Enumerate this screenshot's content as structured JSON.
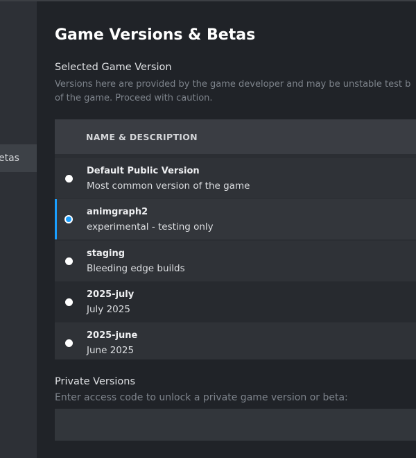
{
  "sidebar": {
    "active_item_label": "etas"
  },
  "page": {
    "title": "Game Versions & Betas"
  },
  "selected_version": {
    "title": "Selected Game Version",
    "description_line1": "Versions here are provided by the game developer and may be unstable test b",
    "description_line2": "of the game. Proceed with caution."
  },
  "versions_table": {
    "column_header": "NAME & DESCRIPTION",
    "rows": [
      {
        "name": "Default Public Version",
        "description": "Most common version of the game",
        "selected": false
      },
      {
        "name": "animgraph2",
        "description": "experimental - testing only",
        "selected": true
      },
      {
        "name": "staging",
        "description": "Bleeding edge builds",
        "selected": false
      },
      {
        "name": "2025-july",
        "description": "July 2025",
        "selected": false
      },
      {
        "name": "2025-june",
        "description": "June 2025",
        "selected": false
      }
    ]
  },
  "private_versions": {
    "title": "Private Versions",
    "description": "Enter access code to unlock a private game version or beta:",
    "input_value": ""
  },
  "colors": {
    "accent": "#1a9fff",
    "background": "#202328"
  }
}
